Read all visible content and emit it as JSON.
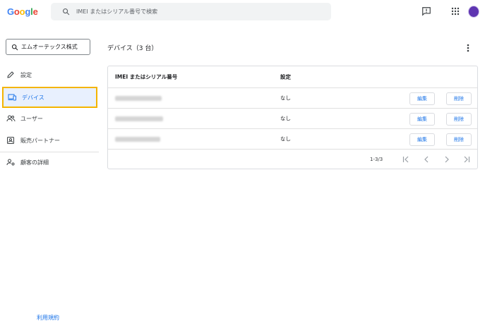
{
  "header": {
    "logo": [
      "G",
      "o",
      "o",
      "g",
      "l",
      "e"
    ],
    "logo_colors": [
      "#4285f4",
      "#ea4335",
      "#fbbc05",
      "#4285f4",
      "#34a853",
      "#ea4335"
    ],
    "search_placeholder": "IMEI またはシリアル番号で検索"
  },
  "sidebar": {
    "search_value": "エムオーテックス株式",
    "items": [
      {
        "label": "設定",
        "icon": "pencil-icon"
      },
      {
        "label": "デバイス",
        "icon": "devices-icon"
      },
      {
        "label": "ユーザー",
        "icon": "people-icon"
      },
      {
        "label": "販売パートナー",
        "icon": "badge-icon"
      },
      {
        "label": "顧客の詳細",
        "icon": "customer-icon"
      }
    ],
    "terms": "利用規約"
  },
  "main": {
    "title": "デバイス（3 台）",
    "table": {
      "columns": [
        "IMEI またはシリアル番号",
        "設定"
      ],
      "rows": [
        {
          "setting": "なし",
          "edit": "編集",
          "delete": "削除"
        },
        {
          "setting": "なし",
          "edit": "編集",
          "delete": "削除"
        },
        {
          "setting": "なし",
          "edit": "編集",
          "delete": "削除"
        }
      ]
    },
    "pagination": "1-3/3"
  },
  "colors": {
    "accent": "#1a73e8",
    "highlight": "#f4b400",
    "avatar": "#5e35b1"
  }
}
